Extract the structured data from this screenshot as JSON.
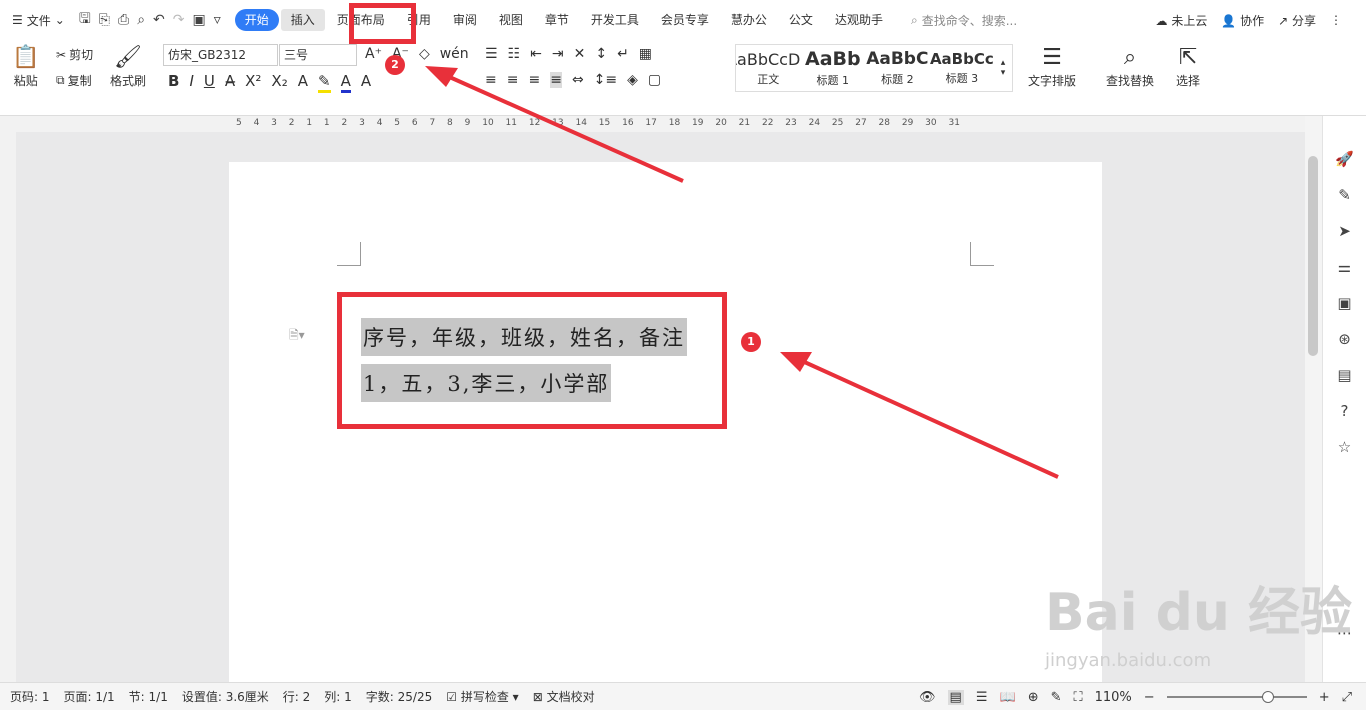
{
  "menu": {
    "file_label": "文件"
  },
  "tabs": [
    {
      "label": "开始"
    },
    {
      "label": "插入"
    },
    {
      "label": "页面布局"
    },
    {
      "label": "引用"
    },
    {
      "label": "审阅"
    },
    {
      "label": "视图"
    },
    {
      "label": "章节"
    },
    {
      "label": "开发工具"
    },
    {
      "label": "会员专享"
    },
    {
      "label": "慧办公"
    },
    {
      "label": "公文"
    },
    {
      "label": "达观助手"
    }
  ],
  "search": {
    "placeholder": "查找命令、搜索..."
  },
  "header_right": {
    "cloud": "未上云",
    "collab": "协作",
    "share": "分享"
  },
  "ribbon": {
    "paste": "粘贴",
    "cut": "剪切",
    "copy": "复制",
    "format_painter": "格式刷",
    "font_name": "仿宋_GB2312",
    "font_size": "三号",
    "styles": [
      {
        "preview": "AaBbCcDd",
        "name": "正文"
      },
      {
        "preview": "AaBb",
        "name": "标题 1"
      },
      {
        "preview": "AaBbC",
        "name": "标题 2"
      },
      {
        "preview": "AaBbCc",
        "name": "标题 3"
      }
    ],
    "text_layout": "文字排版",
    "find_replace": "查找替换",
    "select": "选择"
  },
  "ruler": {
    "numbers": "5 4 3 2 1 1 2 3 4 5 6 7 8 9 10 11 12 13 14 15 16 17 18 19 20 21 22 23 24 25 27 28 29 30 31"
  },
  "document": {
    "line1": "序号，年级，班级，姓名，备注",
    "line2": "1，五，3,李三，小学部"
  },
  "annotations": {
    "marker1": "1",
    "marker2": "2",
    "accent": "#e8303a"
  },
  "watermark": {
    "main": "Bai du 经验",
    "sub": "jingyan.baidu.com"
  },
  "status": {
    "page_code": "页码: 1",
    "page": "页面: 1/1",
    "section": "节: 1/1",
    "setting": "设置值: 3.6厘米",
    "row": "行: 2",
    "col": "列: 1",
    "words": "字数: 25/25",
    "spell": "拼写检查",
    "proof": "文档校对",
    "zoom": "110%"
  }
}
